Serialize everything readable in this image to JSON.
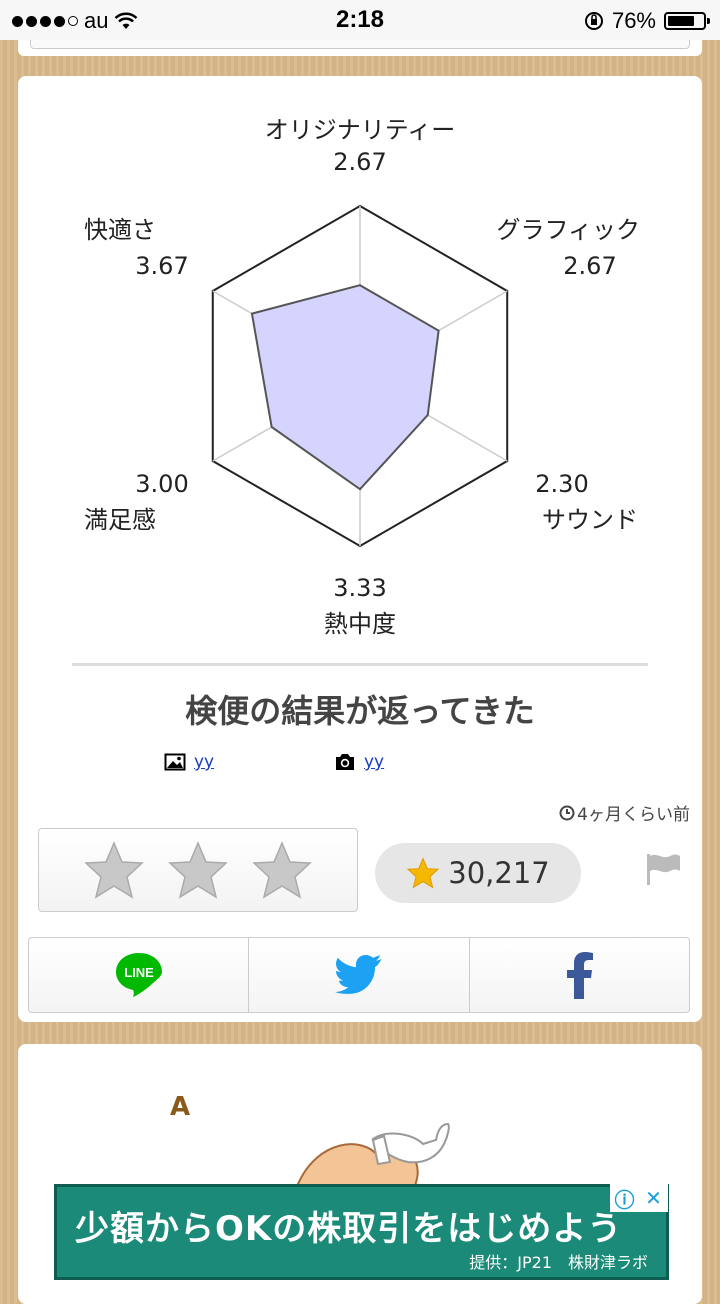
{
  "status_bar": {
    "carrier": "au",
    "time": "2:18",
    "battery": "76%",
    "battery_level": 0.76
  },
  "radar_chart": {
    "labels": [
      {
        "name": "オリジナリティー",
        "value": "2.67"
      },
      {
        "name": "グラフィック",
        "value": "2.67"
      },
      {
        "name": "サウンド",
        "value": "2.30"
      },
      {
        "name": "熱中度",
        "value": "3.33"
      },
      {
        "name": "満足感",
        "value": "3.00"
      },
      {
        "name": "快適さ",
        "value": "3.67"
      }
    ]
  },
  "chart_data": {
    "type": "radar",
    "categories": [
      "オリジナリティー",
      "グラフィック",
      "サウンド",
      "熱中度",
      "満足感",
      "快適さ"
    ],
    "values": [
      2.67,
      2.67,
      2.3,
      3.33,
      3.0,
      3.67
    ],
    "ylim": [
      0,
      5
    ],
    "colors": {
      "fill": "#d4d4ff",
      "stroke": "#555555",
      "grid": "#cccccc"
    }
  },
  "post": {
    "title": "検便の結果が返ってきた",
    "image_author": "yy",
    "photo_author": "yy",
    "time_ago": "4ヶ月くらい前"
  },
  "rating": {
    "stars": 3,
    "count": "30,217"
  },
  "share": {
    "line_label": "LINE"
  },
  "next_card": {
    "letter": "A"
  },
  "ad": {
    "headline": "少額からOKの株取引をはじめよう",
    "sponsor": "提供：JP21　株財津ラボ",
    "info_icon": "ⓘ",
    "close_icon": "✕"
  }
}
